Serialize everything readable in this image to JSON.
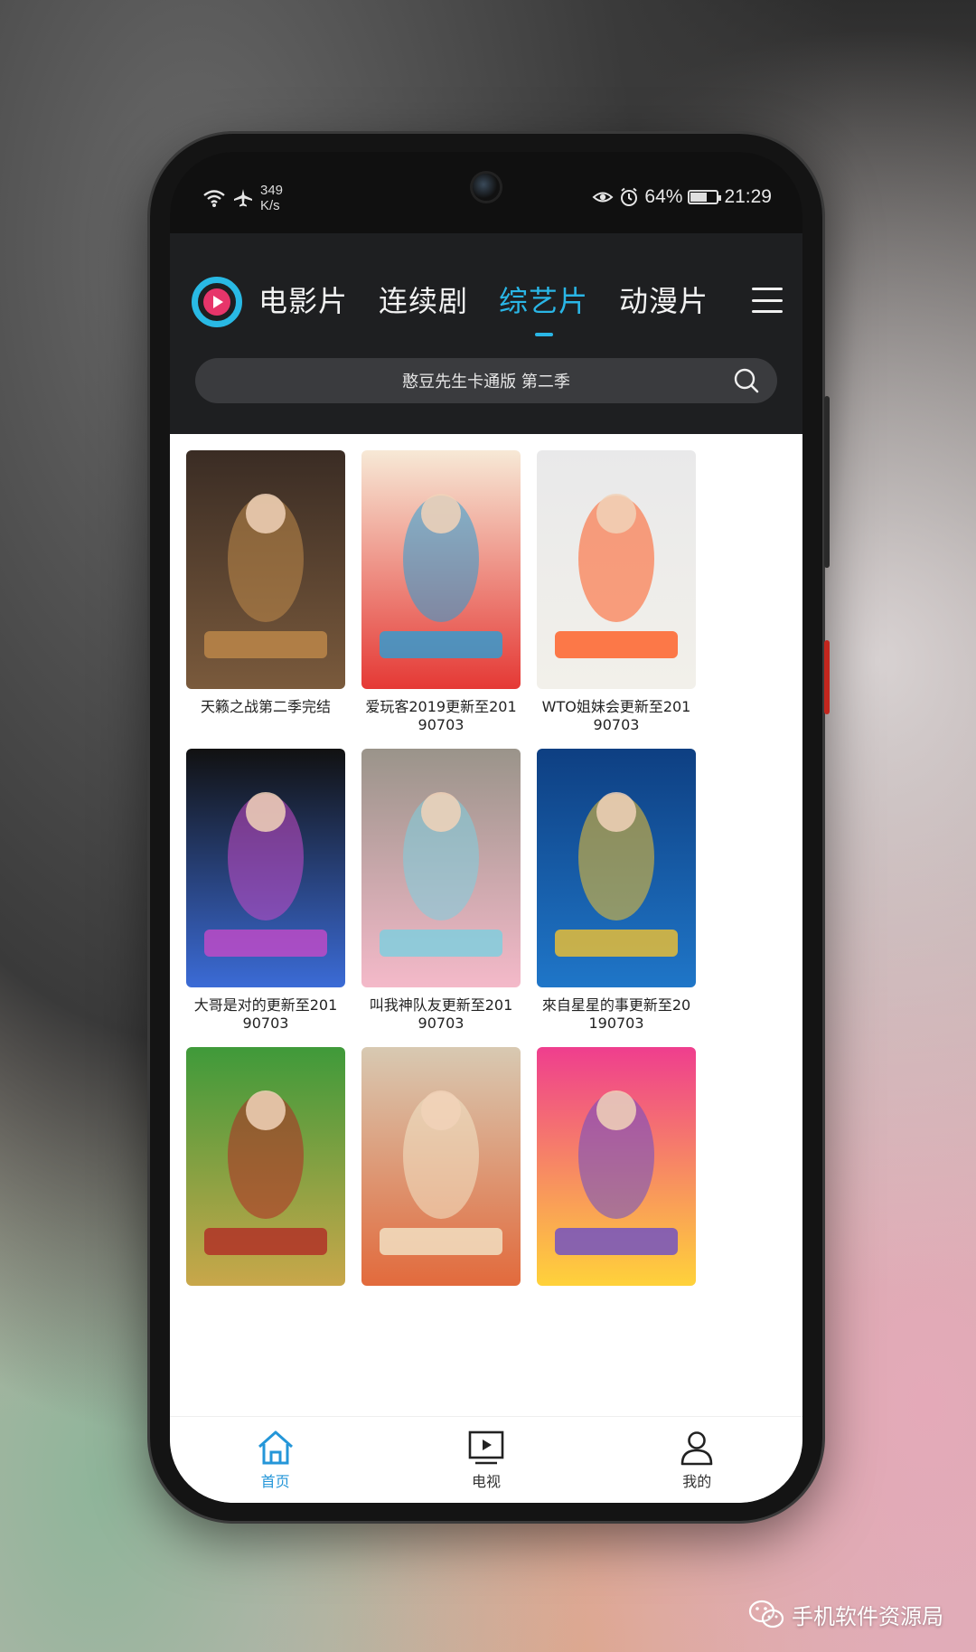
{
  "status_bar": {
    "speed_value": "349",
    "speed_unit": "K/s",
    "battery_percent": "64%",
    "battery_level": 0.64,
    "time": "21:29"
  },
  "header": {
    "tabs": [
      {
        "label": "电影片"
      },
      {
        "label": "连续剧"
      },
      {
        "label": "综艺片"
      },
      {
        "label": "动漫片"
      }
    ],
    "active_tab_index": 2,
    "accent_color": "#2ab6e6"
  },
  "search": {
    "placeholder": "憨豆先生卡通版 第二季"
  },
  "shows": [
    {
      "title": "天籁之战第二季完结",
      "poster_palette": [
        "#3a2c24",
        "#7a5a3c",
        "#c08a4a"
      ]
    },
    {
      "title": "爱玩客2019更新至20190703",
      "poster_palette": [
        "#f7e9d6",
        "#e53935",
        "#2a9fd6"
      ]
    },
    {
      "title": "WTO姐妹会更新至20190703",
      "poster_palette": [
        "#e9e9ea",
        "#f2f0ea",
        "#ff5a1f"
      ]
    },
    {
      "title": "大哥是对的更新至20190703",
      "poster_palette": [
        "#111111",
        "#3b6bd6",
        "#c64ac8"
      ]
    },
    {
      "title": "叫我神队友更新至20190703",
      "poster_palette": [
        "#9a948a",
        "#f4b9c9",
        "#7bcfe0"
      ]
    },
    {
      "title": "來自星星的事更新至20190703",
      "poster_palette": [
        "#0e3f82",
        "#1f76c8",
        "#f2c230"
      ]
    },
    {
      "title": "",
      "poster_palette": [
        "#3f9a3a",
        "#c9a74a",
        "#b02a25"
      ]
    },
    {
      "title": "",
      "poster_palette": [
        "#d8c9b2",
        "#e26a3c",
        "#f3e6c9"
      ]
    },
    {
      "title": "",
      "poster_palette": [
        "#ef3e8e",
        "#ffd23a",
        "#6a4cc8"
      ]
    }
  ],
  "bottom_nav": {
    "items": [
      {
        "label": "首页",
        "icon": "home-icon"
      },
      {
        "label": "电视",
        "icon": "tv-icon"
      },
      {
        "label": "我的",
        "icon": "profile-icon"
      }
    ],
    "active_index": 0,
    "active_color": "#2496d8"
  },
  "watermark": {
    "text": "手机软件资源局"
  }
}
